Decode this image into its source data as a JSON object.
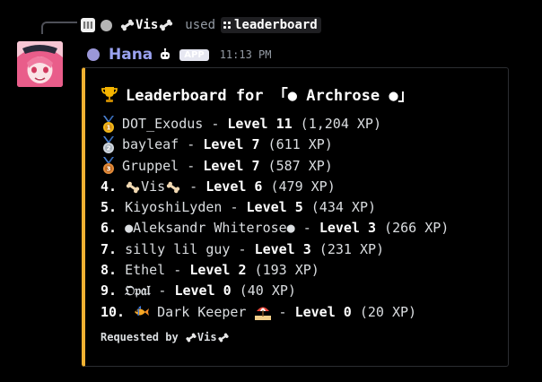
{
  "command_reply": {
    "user_name": "Vis",
    "used_text": "used",
    "command_name": "leaderboard"
  },
  "message": {
    "author": "Hana",
    "app_tag": "APP",
    "time": "11:13 PM"
  },
  "embed": {
    "accent_color": "#f0b232",
    "title": "Leaderboard for 「● Archrose ●」",
    "entries": [
      {
        "rank": "",
        "medal": "gold",
        "name": "DOT_Exodus",
        "sep": " - ",
        "level": "Level 11",
        "xp": " (1,204 XP)"
      },
      {
        "rank": "",
        "medal": "silver",
        "name": "bayleaf",
        "sep": " - ",
        "level": "Level 7",
        "xp": " (611 XP)"
      },
      {
        "rank": "",
        "medal": "bronze",
        "name": "Gruppel",
        "sep": " - ",
        "level": "Level 7",
        "xp": " (587 XP)"
      },
      {
        "rank": "4.",
        "medal": "",
        "name": "Vis",
        "sep": " - ",
        "level": "Level 6",
        "xp": " (479 XP)"
      },
      {
        "rank": "5.",
        "medal": "",
        "name": "KiyoshiLyden",
        "sep": " - ",
        "level": "Level 5",
        "xp": " (434 XP)"
      },
      {
        "rank": "6.",
        "medal": "",
        "name": "●Aleksandr Whiterose●",
        "sep": " - ",
        "level": "Level 3",
        "xp": " (266 XP)"
      },
      {
        "rank": "7.",
        "medal": "",
        "name": "silly lil guy",
        "sep": " - ",
        "level": "Level 3",
        "xp": " (231 XP)"
      },
      {
        "rank": "8.",
        "medal": "",
        "name": "Ethel",
        "sep": " - ",
        "level": "Level 2",
        "xp": " (193 XP)"
      },
      {
        "rank": "9.",
        "medal": "",
        "name": "𝔒𝔭𝔞𝔩",
        "sep": " - ",
        "level": "Level 0",
        "xp": " (40 XP)"
      },
      {
        "rank": "10.",
        "medal": "",
        "name": "Dark Keeper",
        "sep": " - ",
        "level": "Level 0",
        "xp": " (20 XP)"
      }
    ],
    "footer_prefix": "Requested by ",
    "footer_user": "Vis"
  }
}
